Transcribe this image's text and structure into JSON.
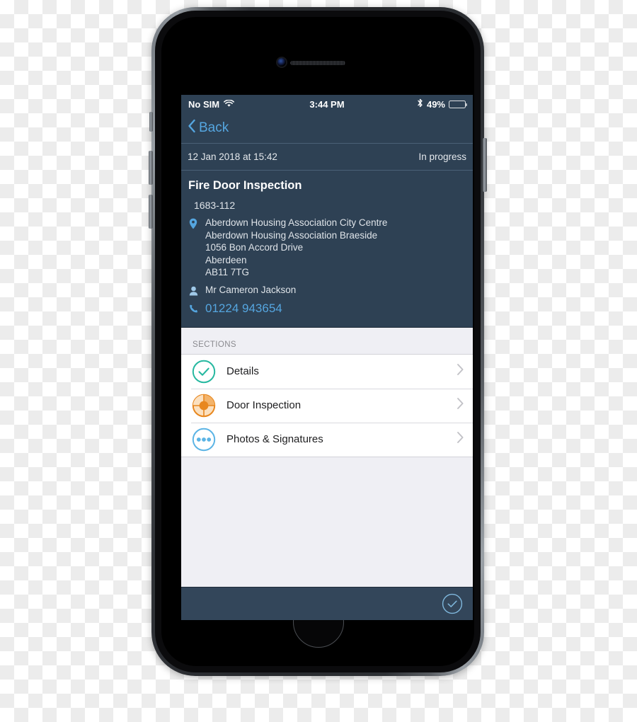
{
  "status_bar": {
    "carrier": "No SIM",
    "wifi_icon": "wifi-icon",
    "time": "3:44 PM",
    "bluetooth_icon": "bluetooth-icon",
    "battery_percent": "49%",
    "battery_level": 49
  },
  "nav": {
    "back_label": "Back",
    "back_icon": "chevron-left-icon"
  },
  "meta": {
    "datetime": "12 Jan 2018 at 15:42",
    "status": "In progress"
  },
  "job": {
    "title": "Fire Door Inspection",
    "reference": "1683-112",
    "location_icon": "map-pin-icon",
    "address_lines": [
      "Aberdown Housing Association City Centre",
      "Aberdown Housing Association Braeside",
      "1056 Bon Accord Drive",
      "Aberdeen",
      "AB11 7TG"
    ],
    "contact_icon": "person-icon",
    "contact_name": "Mr Cameron Jackson",
    "phone_icon": "phone-icon",
    "phone_number": "01224 943654"
  },
  "sections": {
    "header": "SECTIONS",
    "items": [
      {
        "label": "Details",
        "icon": "check-circle-icon",
        "state": "complete",
        "chevron": "chevron-right-icon"
      },
      {
        "label": "Door Inspection",
        "icon": "progress-pie-icon",
        "state": "in-progress",
        "chevron": "chevron-right-icon"
      },
      {
        "label": "Photos & Signatures",
        "icon": "dots-circle-icon",
        "state": "pending",
        "chevron": "chevron-right-icon"
      }
    ]
  },
  "toolbar": {
    "submit_icon": "check-circle-icon"
  },
  "colors": {
    "header_navy": "#2E4154",
    "toolbar_navy": "#33465A",
    "accent_blue": "#55A6E0",
    "complete_teal": "#26B8A0",
    "progress_orange": "#E8871E",
    "pending_blue": "#5BB4E5",
    "list_background": "#EFEFF4"
  }
}
